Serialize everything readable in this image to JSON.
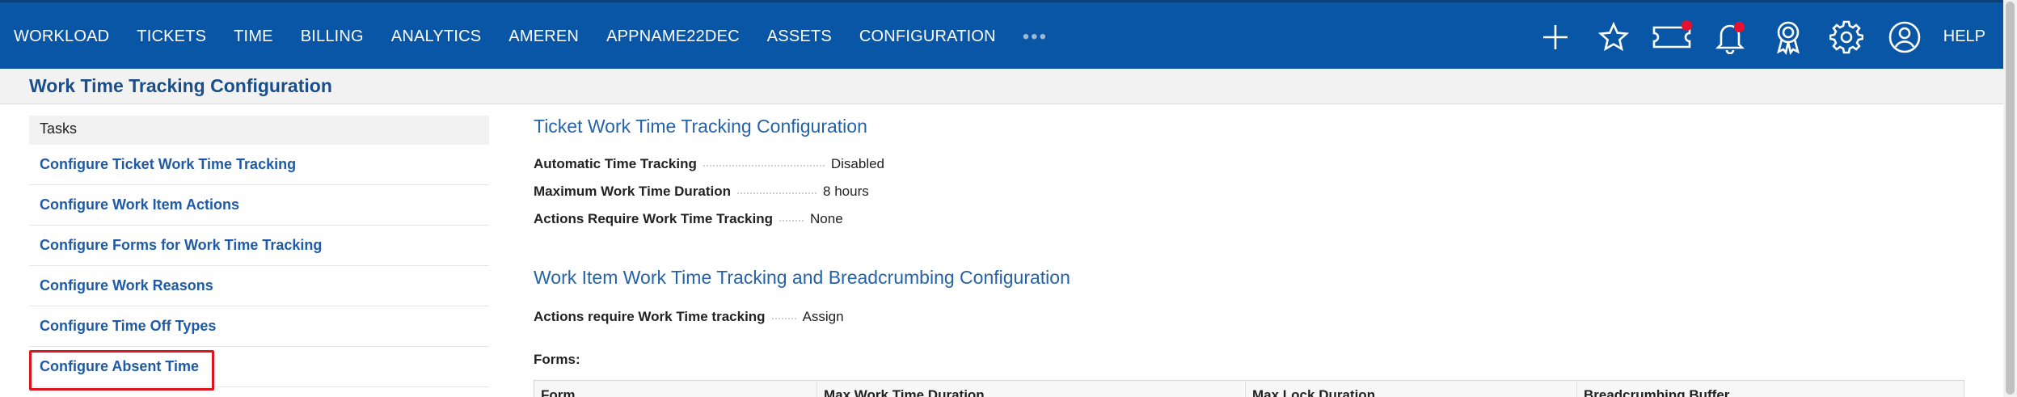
{
  "nav": {
    "items": [
      "WORKLOAD",
      "TICKETS",
      "TIME",
      "BILLING",
      "ANALYTICS",
      "AMEREN",
      "APPNAME22DEC",
      "ASSETS",
      "CONFIGURATION"
    ],
    "more": "•••",
    "help": "HELP",
    "accent": "#0a56a6",
    "notification_dot_color": "#e8112d",
    "tools": [
      "add-icon",
      "star-icon",
      "ticket-icon",
      "bell-icon",
      "award-icon",
      "gear-icon",
      "user-icon"
    ]
  },
  "page": {
    "title": "Work Time Tracking Configuration"
  },
  "sidebar": {
    "heading": "Tasks",
    "items": [
      {
        "label": "Configure Ticket Work Time Tracking"
      },
      {
        "label": "Configure Work Item Actions"
      },
      {
        "label": "Configure Forms for Work Time Tracking"
      },
      {
        "label": "Configure Work Reasons"
      },
      {
        "label": "Configure Time Off Types"
      },
      {
        "label": "Configure Absent Time"
      }
    ],
    "highlight_color": "#e0141e"
  },
  "ticket_section": {
    "title": "Ticket Work Time Tracking Configuration",
    "rows": [
      {
        "key": "Automatic Time Tracking",
        "value": "Disabled"
      },
      {
        "key": "Maximum Work Time Duration",
        "value": "8 hours"
      },
      {
        "key": "Actions Require Work Time Tracking",
        "value": "None"
      }
    ]
  },
  "workitem_section": {
    "title": "Work Item Work Time Tracking and Breadcrumbing Configuration",
    "rows": [
      {
        "key": "Actions require Work Time tracking",
        "value": "Assign"
      }
    ],
    "forms_label": "Forms:",
    "columns": [
      "Form",
      "Max Work Time Duration",
      "Max Lock Duration",
      "Breadcrumbing Buffer"
    ]
  }
}
